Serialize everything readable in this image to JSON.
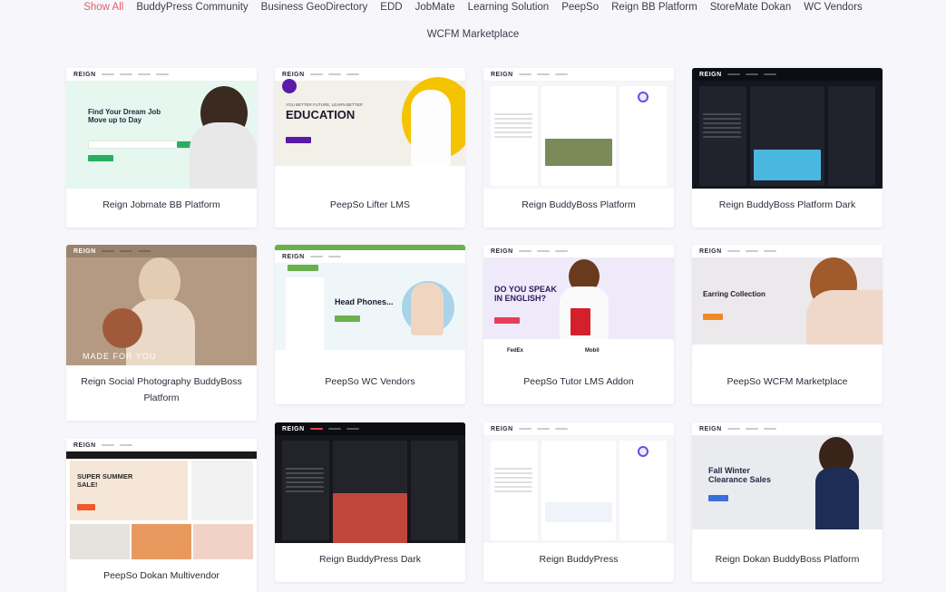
{
  "filters": {
    "row1": [
      "Show All",
      "BuddyPress Community",
      "Business GeoDirectory",
      "EDD",
      "JobMate",
      "Learning Solution",
      "PeepSo",
      "Reign BB Platform",
      "StoreMate Dokan",
      "WC Vendors"
    ],
    "row2": [
      "WCFM Marketplace"
    ],
    "active": "Show All"
  },
  "thumb_text": {
    "jobmate": {
      "logo": "REIGN",
      "heading": "Find Your Dream Job Move up to Day"
    },
    "lifter": {
      "logo": "REIGN",
      "kicker": "YOU BETTER FUTURE, LEARN BETTER",
      "heading": "EDUCATION"
    },
    "photo": {
      "heading": "MADE FOR YOU"
    },
    "wcvendors": {
      "heading": "Head Phones..."
    },
    "tutor": {
      "heading": "DO YOU SPEAK IN ENGLISH?",
      "brands": [
        "FedEx",
        "Mobil"
      ]
    },
    "wcfm": {
      "heading": "Earring Collection"
    },
    "dokan_multi": {
      "heading": "SUPER SUMMER SALE!"
    },
    "dokan_bb": {
      "heading": "Fall Winter Clearance Sales"
    }
  },
  "cards": [
    {
      "title": "Reign Jobmate BB Platform"
    },
    {
      "title": "PeepSo Lifter LMS"
    },
    {
      "title": "Reign BuddyBoss Platform"
    },
    {
      "title": "Reign BuddyBoss Platform Dark"
    },
    {
      "title": "Reign Social Photography BuddyBoss Platform"
    },
    {
      "title": "PeepSo WC Vendors"
    },
    {
      "title": "PeepSo Tutor LMS Addon"
    },
    {
      "title": "PeepSo WCFM Marketplace"
    },
    {
      "title": "PeepSo Dokan Multivendor"
    },
    {
      "title": "Reign BuddyPress Dark"
    },
    {
      "title": "Reign BuddyPress"
    },
    {
      "title": "Reign Dokan BuddyBoss Platform"
    }
  ],
  "colors": {
    "active_filter": "#e35d6a",
    "background": "#f7f7fb"
  }
}
